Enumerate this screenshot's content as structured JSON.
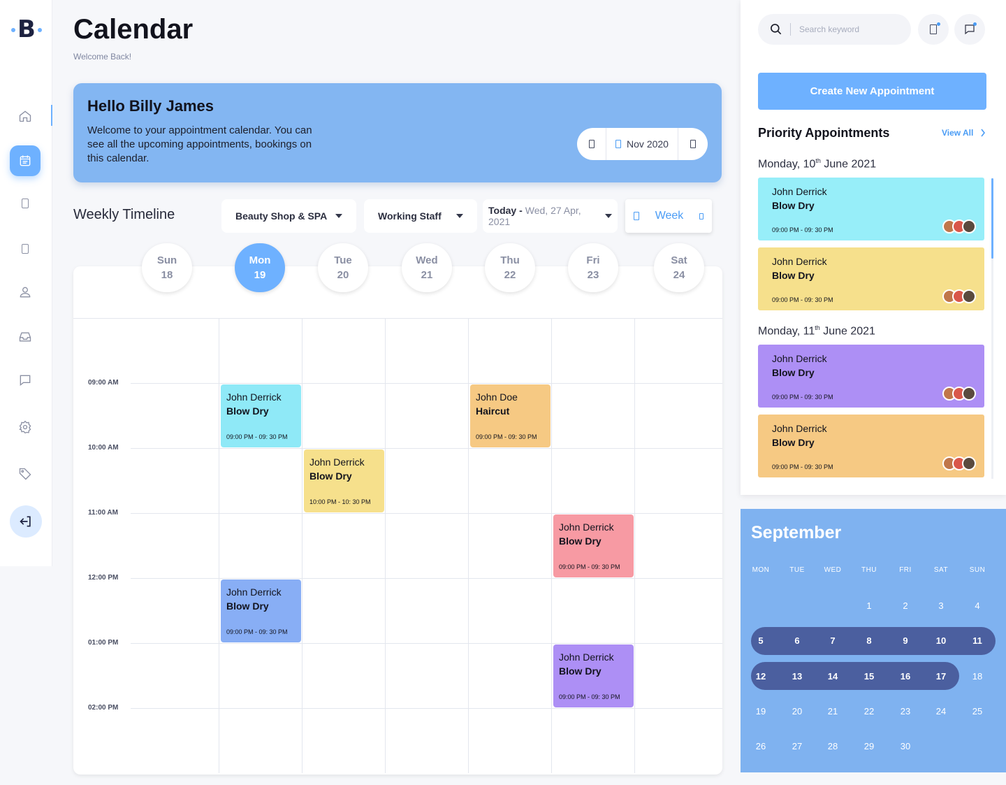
{
  "app": {
    "logo_text": "B",
    "title": "Calendar",
    "subtitle": "Welcome Back!"
  },
  "sidebar": {
    "items": [
      {
        "name": "home",
        "icon": "home-icon"
      },
      {
        "name": "calendar",
        "icon": "calendar-icon",
        "active": true
      },
      {
        "name": "item3",
        "icon": "placeholder-icon"
      },
      {
        "name": "item4",
        "icon": "placeholder-icon"
      },
      {
        "name": "user",
        "icon": "user-icon"
      },
      {
        "name": "inbox",
        "icon": "inbox-icon"
      },
      {
        "name": "messages",
        "icon": "chat-icon"
      },
      {
        "name": "settings",
        "icon": "gear-icon"
      },
      {
        "name": "tags",
        "icon": "tag-icon"
      },
      {
        "name": "logout",
        "icon": "logout-icon"
      }
    ]
  },
  "banner": {
    "title": "Hello Billy James",
    "text": "Welcome to your appointment calendar. You can see all the upcoming appointments, bookings on this calendar.",
    "month_label": "Nov 2020"
  },
  "toolbar": {
    "section_title": "Weekly Timeline",
    "shop": "Beauty Shop & SPA",
    "staff": "Working Staff",
    "date_prefix": "Today -",
    "date_value": "Wed, 27 Apr, 2021",
    "view": "Week"
  },
  "week": {
    "days": [
      {
        "name": "Sun",
        "num": "18"
      },
      {
        "name": "Mon",
        "num": "19",
        "active": true
      },
      {
        "name": "Tue",
        "num": "20"
      },
      {
        "name": "Wed",
        "num": "21"
      },
      {
        "name": "Thu",
        "num": "22"
      },
      {
        "name": "Fri",
        "num": "23"
      },
      {
        "name": "Sat",
        "num": "24"
      }
    ],
    "times": [
      "09:00 AM",
      "10:00 AM",
      "11:00 AM",
      "12:00 PM",
      "01:00 PM",
      "02:00 PM"
    ]
  },
  "events": [
    {
      "name": "John Derrick",
      "service": "Blow Dry",
      "time": "09:00 PM - 09: 30 PM",
      "color": "#8fe9f7"
    },
    {
      "name": "John Doe",
      "service": "Haircut",
      "time": "09:00 PM - 09: 30 PM",
      "color": "#f6c983"
    },
    {
      "name": "John Derrick",
      "service": "Blow Dry",
      "time": "10:00 PM - 10: 30 PM",
      "color": "#f6e08c"
    },
    {
      "name": "John Derrick",
      "service": "Blow Dry",
      "time": "09:00 PM - 09: 30 PM",
      "color": "#f79aa3"
    },
    {
      "name": "John Derrick",
      "service": "Blow Dry",
      "time": "09:00 PM - 09: 30 PM",
      "color": "#88aef5"
    },
    {
      "name": "John Derrick",
      "service": "Blow Dry",
      "time": "09:00 PM - 09: 30 PM",
      "color": "#ad8ff5"
    }
  ],
  "right_panel": {
    "search_placeholder": "Search keyword",
    "create_button": "Create New Appointment",
    "priority_title": "Priority Appointments",
    "view_all": "View All",
    "groups": [
      {
        "date_prefix": "Monday, 10",
        "date_sup": "th",
        "date_suffix": " June 2021",
        "cards": [
          {
            "name": "John Derrick",
            "service": "Blow Dry",
            "time": "09:00 PM - 09: 30 PM",
            "color": "#97eef9"
          },
          {
            "name": "John Derrick",
            "service": "Blow Dry",
            "time": "09:00 PM - 09: 30 PM",
            "color": "#f6e08c"
          }
        ]
      },
      {
        "date_prefix": "Monday, 11",
        "date_sup": "th",
        "date_suffix": " June 2021",
        "cards": [
          {
            "name": "John Derrick",
            "service": "Blow Dry",
            "time": "09:00 PM - 09: 30 PM",
            "color": "#ad8ff5"
          },
          {
            "name": "John Derrick",
            "service": "Blow Dry",
            "time": "09:00 PM - 09: 30 PM",
            "color": "#f6c983"
          }
        ]
      }
    ]
  },
  "mini_calendar": {
    "month": "September",
    "weekdays": [
      "MON",
      "TUE",
      "WED",
      "THU",
      "FRI",
      "SAT",
      "SUN"
    ],
    "weeks": [
      [
        "",
        "",
        "",
        "1",
        "2",
        "3",
        "4"
      ],
      [
        "5",
        "6",
        "7",
        "8",
        "9",
        "10",
        "11"
      ],
      [
        "12",
        "13",
        "14",
        "15",
        "16",
        "17",
        "18"
      ],
      [
        "19",
        "20",
        "21",
        "22",
        "23",
        "24",
        "25"
      ],
      [
        "26",
        "27",
        "28",
        "29",
        "30",
        "",
        ""
      ]
    ],
    "highlight_color": "#4b5f9f"
  }
}
